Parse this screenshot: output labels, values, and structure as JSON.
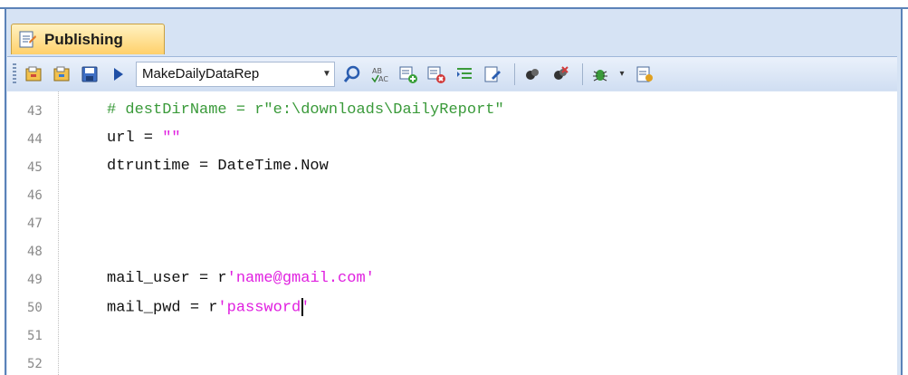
{
  "tab": {
    "label": "Publishing"
  },
  "toolbar": {
    "script_select_value": "MakeDailyDataRep",
    "icons": [
      "open-script-icon",
      "save-as-icon",
      "save-icon",
      "run-icon",
      "search-icon",
      "spell-check-icon",
      "add-icon",
      "remove-icon",
      "indent-icon",
      "edit-icon",
      "breakpoint-icon",
      "clear-breakpoints-icon",
      "debug-icon",
      "script-settings-icon"
    ]
  },
  "editor": {
    "lines": [
      {
        "num": "43",
        "code": "# destDirName = r\"e:\\downloads\\DailyReport\""
      },
      {
        "num": "44",
        "prefix": "url = ",
        "string": "\"\""
      },
      {
        "num": "45",
        "code": "dtruntime = DateTime.Now"
      },
      {
        "num": "46",
        "code": ""
      },
      {
        "num": "47",
        "code": ""
      },
      {
        "num": "48",
        "code": ""
      },
      {
        "num": "49",
        "prefix": "mail_user = r",
        "string": "'name@gmail.com'"
      },
      {
        "num": "50",
        "prefix": "mail_pwd = r",
        "string": "'password",
        "string_end": "'"
      },
      {
        "num": "51",
        "code": ""
      },
      {
        "num": "52",
        "code": ""
      }
    ]
  },
  "colors": {
    "comment": "#3a9a3a",
    "string": "#e020e0",
    "frame": "#5b82b8",
    "tab": "#ffd06a"
  }
}
